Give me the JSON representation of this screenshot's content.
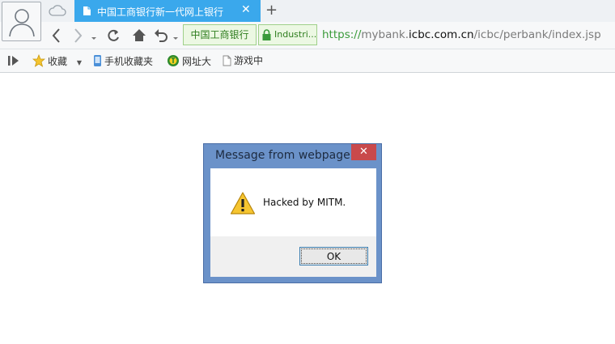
{
  "browser": {
    "tab_title": "中国工商银行新一代网上银行",
    "tab_close": "✕",
    "new_tab": "+",
    "site_identity": "中国工商银行",
    "cert_label": "Industri...",
    "url": {
      "protocol": "https://",
      "subdomain": "mybank.",
      "domain": "icbc.com.cn",
      "path": "/icbc/perbank/index.jsp"
    }
  },
  "bookmarks": {
    "favorites": "收藏",
    "mobile_favorites": "手机收藏夹",
    "url_portal": "网址大",
    "games": "游戏中"
  },
  "dialog": {
    "title": "Message from webpage",
    "close": "✕",
    "message": "Hacked by MITM.",
    "ok_label": "OK"
  },
  "colors": {
    "tab_active": "#3aa8ec",
    "dialog_frame": "#6b92c9",
    "dialog_close": "#c9494b",
    "secure_green": "#3a9a3a"
  }
}
